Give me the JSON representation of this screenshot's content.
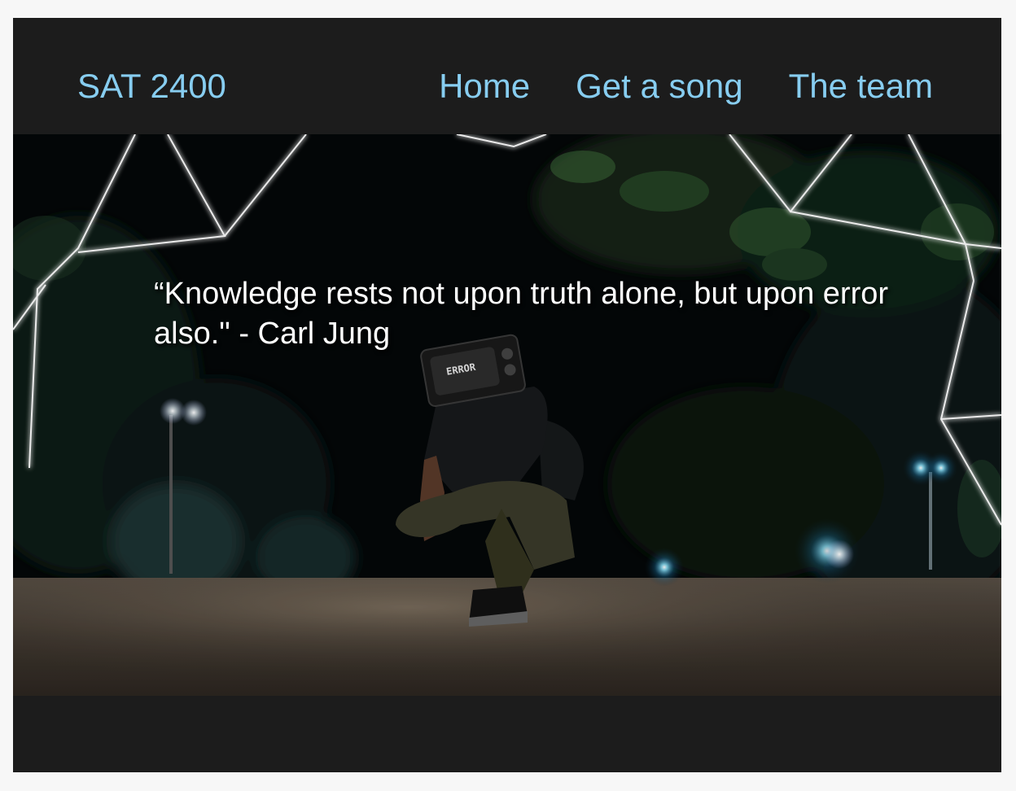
{
  "navbar": {
    "brand": "SAT 2400",
    "links": [
      "Home",
      "Get a song",
      "The team"
    ]
  },
  "hero": {
    "quote": "“Knowledge rests not upon truth alone, but upon error also.\" - Carl Jung",
    "tv_screen_text": "ERROR"
  },
  "colors": {
    "page_background": "#f7f7f7",
    "frame_background": "#1c1c1c",
    "link_color": "#87cdf0",
    "quote_color": "#ffffff"
  }
}
